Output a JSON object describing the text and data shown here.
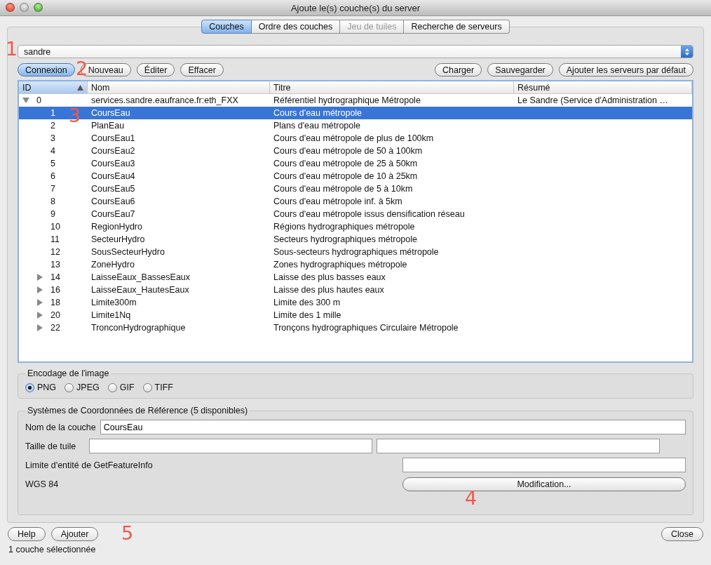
{
  "window": {
    "title": "Ajoute le(s) couche(s) du server"
  },
  "tabs": [
    {
      "label": "Couches",
      "selected": true,
      "disabled": false
    },
    {
      "label": "Ordre des couches",
      "selected": false,
      "disabled": false
    },
    {
      "label": "Jeu de tuiles",
      "selected": false,
      "disabled": true
    },
    {
      "label": "Recherche de serveurs",
      "selected": false,
      "disabled": false
    }
  ],
  "server_select": {
    "value": "sandre"
  },
  "toolbar_left": [
    {
      "label": "Connexion",
      "selected": true
    },
    {
      "label": "Nouveau",
      "selected": false
    },
    {
      "label": "Éditer",
      "selected": false
    },
    {
      "label": "Effacer",
      "selected": false
    }
  ],
  "toolbar_right": [
    "Charger",
    "Sauvegarder",
    "Ajouter les serveurs par défaut"
  ],
  "table": {
    "columns": [
      {
        "label": "ID",
        "sorted": true
      },
      {
        "label": "Nom",
        "sorted": false
      },
      {
        "label": "Titre",
        "sorted": false
      },
      {
        "label": "Résumé",
        "sorted": false
      }
    ],
    "rows": [
      {
        "id": "0",
        "name": "services.sandre.eaufrance.fr:eth_FXX",
        "title": "Référentiel hydrographique Métropole",
        "summary": "Le Sandre (Service d'Administration …",
        "kind": "group",
        "expanded": true,
        "selected": false,
        "children": [
          {
            "id": "1",
            "name": "CoursEau",
            "title": "Cours d'eau métropole",
            "kind": "leaf",
            "selected": true,
            "annotation": "3"
          },
          {
            "id": "2",
            "name": "PlanEau",
            "title": "Plans d'eau métropole",
            "kind": "leaf",
            "selected": false
          },
          {
            "id": "3",
            "name": "CoursEau1",
            "title": "Cours d'eau métropole de plus de 100km",
            "kind": "leaf",
            "selected": false
          },
          {
            "id": "4",
            "name": "CoursEau2",
            "title": "Cours d'eau métropole de 50 à 100km",
            "kind": "leaf",
            "selected": false
          },
          {
            "id": "5",
            "name": "CoursEau3",
            "title": "Cours d'eau métropole de 25 à 50km",
            "kind": "leaf",
            "selected": false
          },
          {
            "id": "6",
            "name": "CoursEau4",
            "title": "Cours d'eau métropole de 10 à 25km",
            "kind": "leaf",
            "selected": false
          },
          {
            "id": "7",
            "name": "CoursEau5",
            "title": "Cours d'eau métropole de 5 à 10km",
            "kind": "leaf",
            "selected": false
          },
          {
            "id": "8",
            "name": "CoursEau6",
            "title": "Cours d'eau métropole inf. à 5km",
            "kind": "leaf",
            "selected": false
          },
          {
            "id": "9",
            "name": "CoursEau7",
            "title": "Cours d'eau métropole issus densification réseau",
            "kind": "leaf",
            "selected": false
          },
          {
            "id": "10",
            "name": "RegionHydro",
            "title": "Régions hydrographiques métropole",
            "kind": "leaf",
            "selected": false
          },
          {
            "id": "11",
            "name": "SecteurHydro",
            "title": "Secteurs hydrographiques métropole",
            "kind": "leaf",
            "selected": false
          },
          {
            "id": "12",
            "name": "SousSecteurHydro",
            "title": "Sous-secteurs hydrographiques métropole",
            "kind": "leaf",
            "selected": false
          },
          {
            "id": "13",
            "name": "ZoneHydro",
            "title": "Zones hydrographiques métropole",
            "kind": "leaf",
            "selected": false
          },
          {
            "id": "14",
            "name": "LaisseEaux_BassesEaux",
            "title": "Laisse des plus basses eaux",
            "kind": "group",
            "expanded": false,
            "selected": false
          },
          {
            "id": "16",
            "name": "LaisseEaux_HautesEaux",
            "title": "Laisse des plus hautes eaux",
            "kind": "group",
            "expanded": false,
            "selected": false
          },
          {
            "id": "18",
            "name": "Limite300m",
            "title": "Limite des 300 m",
            "kind": "group",
            "expanded": false,
            "selected": false
          },
          {
            "id": "20",
            "name": "Limite1Nq",
            "title": "Limite des 1 mille",
            "kind": "group",
            "expanded": false,
            "selected": false
          },
          {
            "id": "22",
            "name": "TronconHydrographique",
            "title": "Tronçons hydrographiques Circulaire Métropole",
            "kind": "group",
            "expanded": false,
            "selected": false
          }
        ]
      }
    ]
  },
  "encoding": {
    "legend": "Encodage de l'image",
    "options": [
      {
        "label": "PNG",
        "selected": true
      },
      {
        "label": "JPEG",
        "selected": false
      },
      {
        "label": "GIF",
        "selected": false
      },
      {
        "label": "TIFF",
        "selected": false
      }
    ]
  },
  "crs": {
    "legend": "Systèmes de Coordonnées de Référence (5 disponibles)",
    "layer_name_label": "Nom de la couche",
    "layer_name_value": "CoursEau",
    "tile_size_label": "Taille de tuile",
    "feature_limit_label": "Limite d'entité de GetFeatureInfo",
    "system": "WGS 84",
    "modify_button": "Modification..."
  },
  "footer_buttons": {
    "left": [
      "Help",
      "Ajouter"
    ],
    "right": "Close"
  },
  "status_bar": "1 couche sélectionnée",
  "annotations": [
    "1",
    "2",
    "4",
    "5"
  ]
}
